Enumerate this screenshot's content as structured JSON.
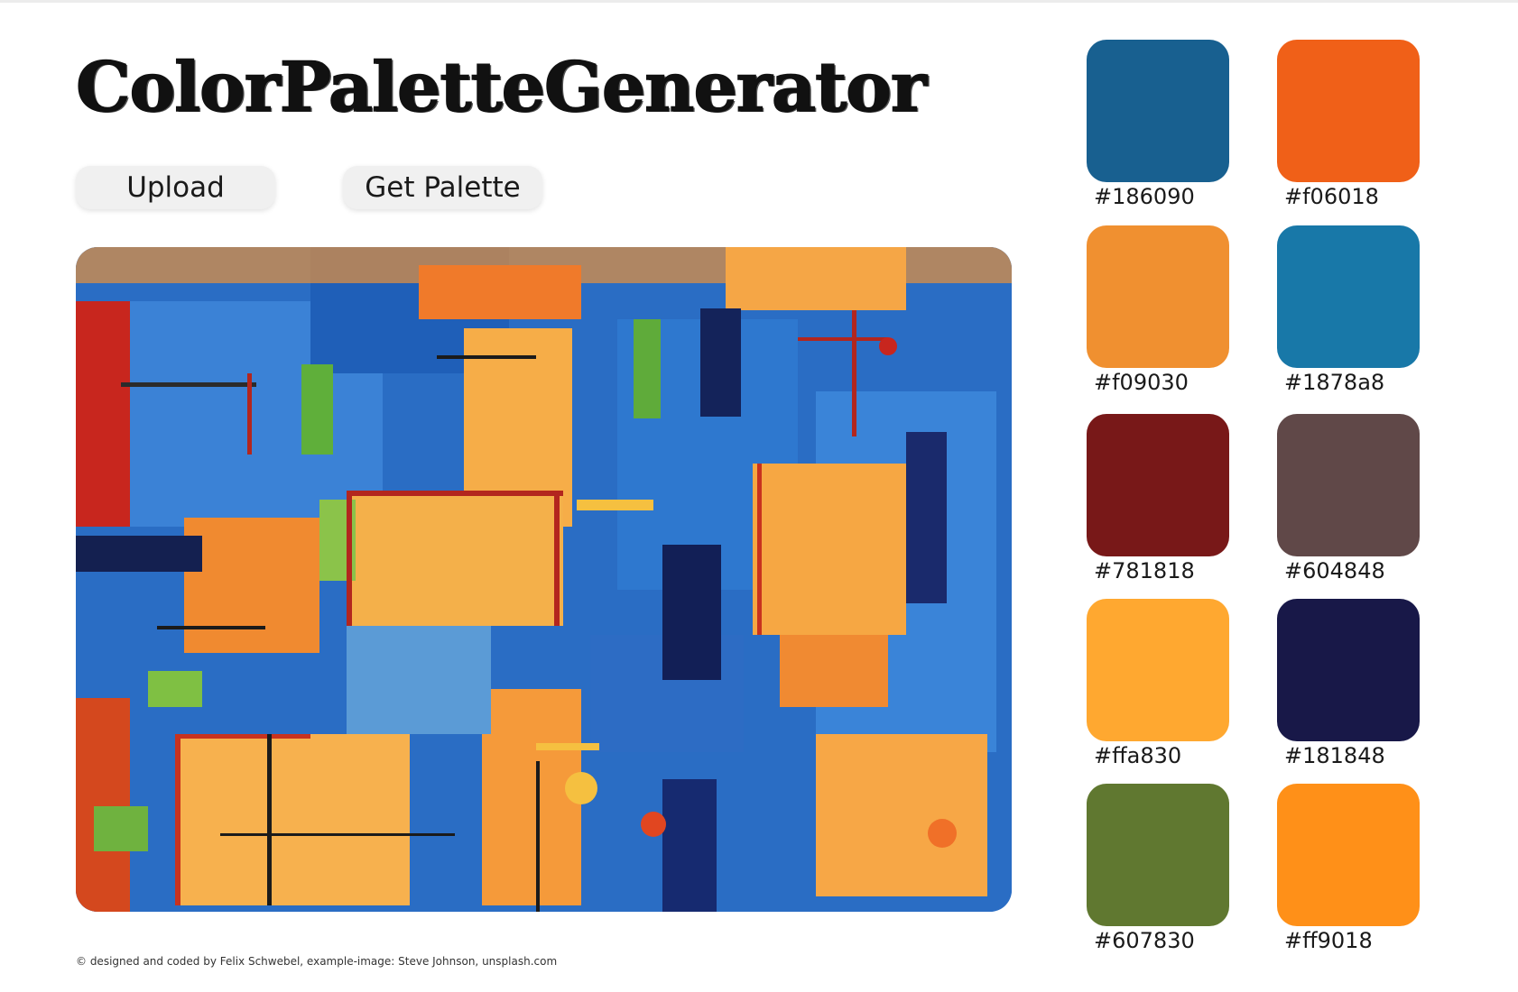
{
  "app": {
    "title": "ColorPaletteGenerator"
  },
  "toolbar": {
    "upload_label": "Upload",
    "get_palette_label": "Get Palette"
  },
  "footer": {
    "credit": "© designed and coded by Felix Schwebel, example-image: Steve Johnson, unsplash.com"
  },
  "palette": [
    {
      "hex": "#186090",
      "label": "#186090"
    },
    {
      "hex": "#f06018",
      "label": "#f06018"
    },
    {
      "hex": "#f09030",
      "label": "#f09030"
    },
    {
      "hex": "#1878a8",
      "label": "#1878a8"
    },
    {
      "hex": "#781818",
      "label": "#781818"
    },
    {
      "hex": "#604848",
      "label": "#604848"
    },
    {
      "hex": "#ffa830",
      "label": "#ffa830"
    },
    {
      "hex": "#181848",
      "label": "#181848"
    },
    {
      "hex": "#607830",
      "label": "#607830"
    },
    {
      "hex": "#ff9018",
      "label": "#ff9018"
    }
  ],
  "image": {
    "subject": "abstract-painting"
  }
}
